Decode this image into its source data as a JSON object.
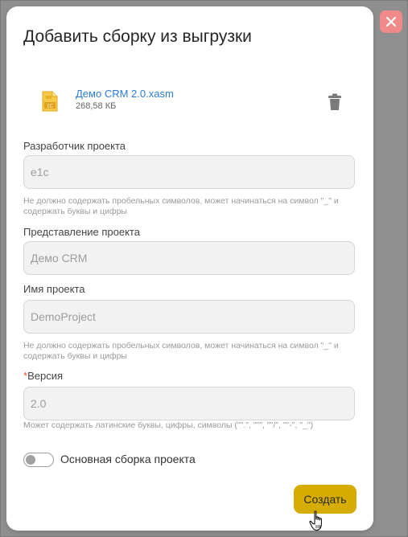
{
  "dialog": {
    "title": "Добавить сборку из выгрузки"
  },
  "file": {
    "name": "Демо CRM 2.0.xasm",
    "size": "268,58 КБ",
    "icon": "1c-file-icon",
    "icon_text": "1C"
  },
  "fields": {
    "developer": {
      "label": "Разработчик проекта",
      "value": "e1c",
      "hint": "Не должно содержать пробельных символов, может начинаться на символ \"_\" и содержать буквы и цифры"
    },
    "representation": {
      "label": "Представление проекта",
      "value": "Демо CRM"
    },
    "project_name": {
      "label": "Имя проекта",
      "value": "DemoProject",
      "hint": "Не должно содержать пробельных символов, может начинаться на символ \"_\" и содержать буквы и цифры"
    },
    "version": {
      "required_mark": "*",
      "label": "Версия",
      "value": "2.0",
      "hint": "Может содержать латинские буквы, цифры, символы (\"\".\", \"\"\", \"\"/\", \"\"-\", \"_\")"
    }
  },
  "toggle": {
    "label": "Основная сборка проекта",
    "enabled": false
  },
  "buttons": {
    "create": "Создать"
  },
  "colors": {
    "accent": "#d6ac00",
    "link": "#2b7bd6",
    "close": "#f08a8a",
    "required": "#e0533b"
  }
}
